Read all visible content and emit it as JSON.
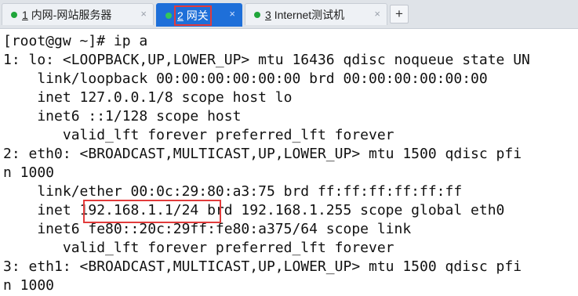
{
  "tabs": [
    {
      "index": "1",
      "label": "内网-网站服务器",
      "close": "×",
      "status_color": "#1fa53a"
    },
    {
      "index": "2",
      "label": "网关",
      "close": "×",
      "status_color": "#34c759"
    },
    {
      "index": "3",
      "label": "Internet测试机",
      "close": "×",
      "status_color": "#1fa53a"
    }
  ],
  "add_tab": "+",
  "active_tab": 2,
  "highlight_color": "#e23b3b",
  "terminal": {
    "lines": [
      "[root@gw ~]# ip a",
      "1: lo: <LOOPBACK,UP,LOWER_UP> mtu 16436 qdisc noqueue state UN",
      "    link/loopback 00:00:00:00:00:00 brd 00:00:00:00:00:00",
      "    inet 127.0.0.1/8 scope host lo",
      "    inet6 ::1/128 scope host",
      "       valid_lft forever preferred_lft forever",
      "2: eth0: <BROADCAST,MULTICAST,UP,LOWER_UP> mtu 1500 qdisc pfi",
      "n 1000",
      "    link/ether 00:0c:29:80:a3:75 brd ff:ff:ff:ff:ff:ff",
      "    inet 192.168.1.1/24 brd 192.168.1.255 scope global eth0",
      "    inet6 fe80::20c:29ff:fe80:a375/64 scope link",
      "       valid_lft forever preferred_lft forever",
      "3: eth1: <BROADCAST,MULTICAST,UP,LOWER_UP> mtu 1500 qdisc pfi",
      "n 1000"
    ],
    "highlighted_text": "192.168.1.1/24"
  }
}
